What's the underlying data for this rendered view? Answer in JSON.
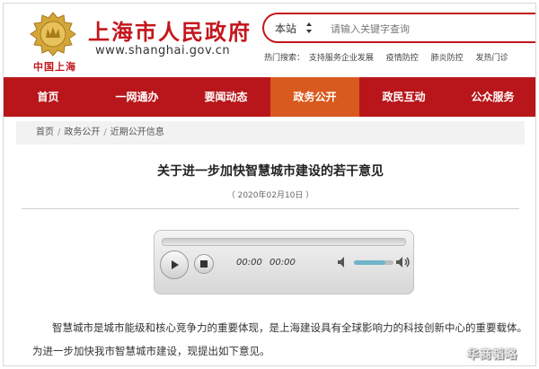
{
  "header": {
    "emblem_text": "中国上海",
    "site_title": "上海市人民政府",
    "site_url": "www.shanghai.gov.cn"
  },
  "search": {
    "scope": "本站",
    "placeholder": "请输入关键字查询"
  },
  "hot_search": {
    "label": "热门搜索：",
    "items": [
      "支持服务企业发展",
      "疫情防控",
      "肺炎防控",
      "发热门诊"
    ]
  },
  "nav": {
    "items": [
      {
        "label": "首页",
        "active": false
      },
      {
        "label": "一网通办",
        "active": false
      },
      {
        "label": "要闻动态",
        "active": false
      },
      {
        "label": "政务公开",
        "active": true
      },
      {
        "label": "政民互动",
        "active": false
      },
      {
        "label": "公众服务",
        "active": false
      }
    ]
  },
  "breadcrumb": [
    "首页",
    "政务公开",
    "近期公开信息"
  ],
  "article": {
    "title": "关于进一步加快智慧城市建设的若干意见",
    "date": "（ 2020年02月10日 ）",
    "paragraph": "智慧城市是城市能级和核心竞争力的重要体现，是上海建设具有全球影响力的科技创新中心的重要载体。为进一步加快我市智慧城市建设，现提出如下意见。"
  },
  "player": {
    "current_time": "00:00",
    "duration": "00:00",
    "progress": 0,
    "volume": 0.8
  },
  "watermark": "华商韬略",
  "colors": {
    "brand_red": "#c4161c",
    "nav_red": "#b8161a",
    "nav_active": "#d95a1e"
  }
}
